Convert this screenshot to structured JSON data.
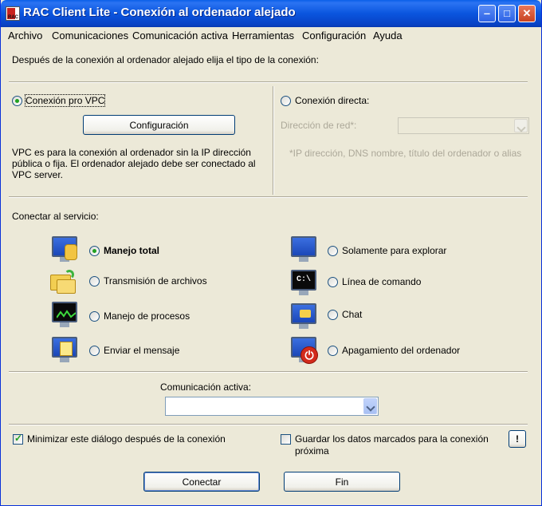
{
  "window": {
    "title": "RAC Client Lite - Conexión al ordenador alejado",
    "app_icon_text": "RAC"
  },
  "menu": [
    "Archivo",
    "Comunicaciones",
    "Comunicación activa",
    "Herramientas",
    "Configuración",
    "Ayuda"
  ],
  "hint": "Después de la conexión al ordenador alejado elija el tipo de la conexión:",
  "connection": {
    "vpc_label": "Conexión pro VPC",
    "vpc_checked": true,
    "config_button": "Configuración",
    "vpc_description": "VPC es para la conexión al ordenador sin la IP dirección pública o fija. El ordenador alejado debe ser conectado al VPC server.",
    "direct_label": "Conexión directa:",
    "direct_checked": false,
    "address_label": "Dirección de red*:",
    "address_value": "",
    "address_note": "*IP dirección, DNS nombre, título del ordenador o alias"
  },
  "service": {
    "heading": "Conectar al servicio:",
    "options": [
      {
        "label": "Manejo total",
        "icon": "monitor-hand-icon",
        "checked": true
      },
      {
        "label": "Transmisión de archivos",
        "icon": "folder-transfer-icon",
        "checked": false
      },
      {
        "label": "Manejo de procesos",
        "icon": "process-monitor-icon",
        "checked": false
      },
      {
        "label": "Enviar el mensaje",
        "icon": "message-note-icon",
        "checked": false
      },
      {
        "label": "Solamente para explorar",
        "icon": "monitor-view-icon",
        "checked": false
      },
      {
        "label": "Línea de comando",
        "icon": "command-line-icon",
        "checked": false
      },
      {
        "label": "Chat",
        "icon": "chat-icon",
        "checked": false
      },
      {
        "label": "Apagamiento del ordenador",
        "icon": "power-icon",
        "checked": false
      }
    ],
    "cmd_icon_text": "C:\\"
  },
  "active": {
    "label": "Comunicación activa:",
    "value": ""
  },
  "options": {
    "minimize_label": "Minimizar este diálogo después de la conexión",
    "minimize_checked": true,
    "save_label": "Guardar los datos marcados para la conexión próxima",
    "save_checked": false,
    "info_button": "!"
  },
  "buttons": {
    "connect": "Conectar",
    "end": "Fin"
  },
  "colors": {
    "titlebar": "#0A55DE",
    "window_bg": "#ECE9D8",
    "radio_dot": "#21A121"
  }
}
